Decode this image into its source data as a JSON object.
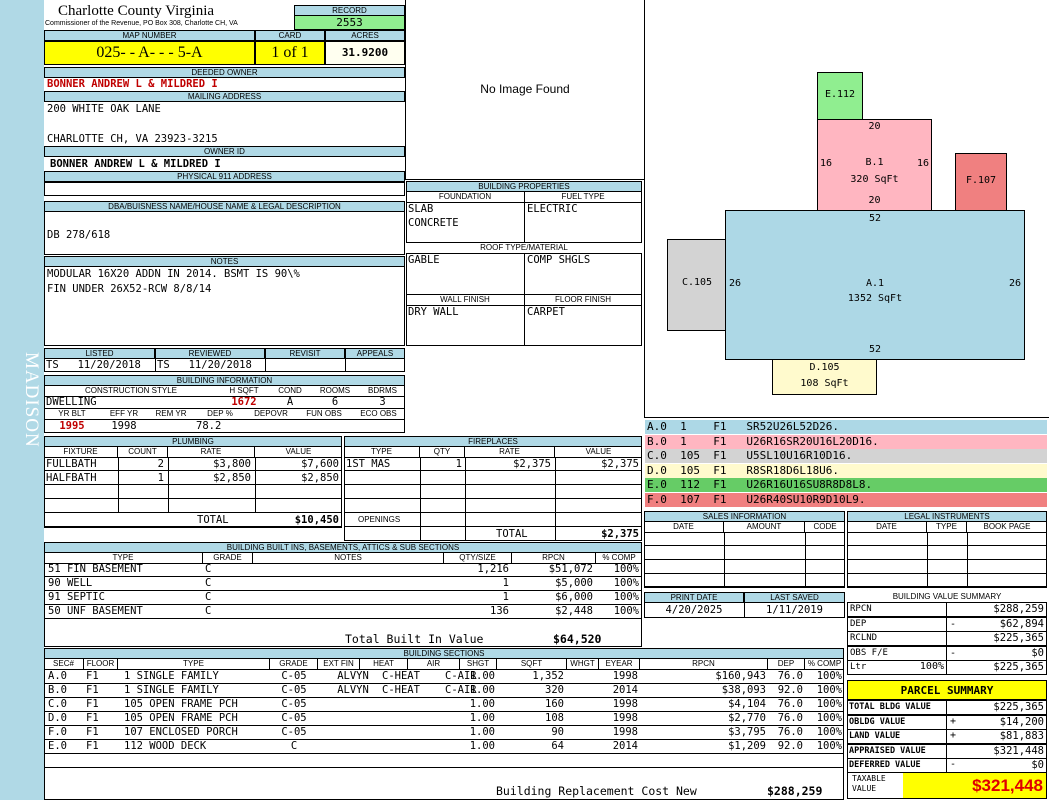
{
  "sidebar": {
    "district": "MADISON"
  },
  "header": {
    "county": "Charlotte County Virginia",
    "subtitle": "Commissioner of the Revenue, PO Box 308, Charlotte CH, VA",
    "record_label": "RECORD",
    "record": "2553",
    "map_label": "MAP NUMBER",
    "map_number": "025- - A- - - 5-A",
    "card_label": "CARD",
    "card": "1 of 1",
    "acres_label": "ACRES",
    "acres": "31.9200"
  },
  "owner": {
    "deeded_label": "DEEDED OWNER",
    "deeded": "BONNER ANDREW L & MILDRED I",
    "mailing_label": "MAILING ADDRESS",
    "addr1": "200 WHITE OAK LANE",
    "addr2": "CHARLOTTE CH, VA 23923-3215",
    "owner_id_label": "OWNER ID",
    "owner_id": "BONNER ANDREW L & MILDRED I",
    "physical_label": "PHYSICAL 911 ADDRESS",
    "physical": ""
  },
  "dba": {
    "label": "DBA/BUISNESS NAME/HOUSE NAME & LEGAL DESCRIPTION",
    "value": "DB 278/618"
  },
  "notes": {
    "label": "NOTES",
    "line1": "MODULAR 16X20 ADDN IN 2014. BSMT IS 90\\%",
    "line2": "FIN UNDER 26X52-RCW 8/8/14"
  },
  "listed": {
    "listed_label": "LISTED",
    "listed": "TS   11/20/2018",
    "reviewed_label": "REVIEWED",
    "reviewed": "TS   11/20/2018",
    "revisit_label": "REVISIT",
    "appeals_label": "APPEALS"
  },
  "photo": {
    "text": "No Image Found"
  },
  "building_props": {
    "label": "BUILDING PROPERTIES",
    "foundation_label": "FOUNDATION",
    "foundation1": "SLAB",
    "foundation2": "CONCRETE",
    "fuel_label": "FUEL TYPE",
    "fuel": "ELECTRIC",
    "roof_label": "ROOF TYPE/MATERIAL",
    "roof_type": "GABLE",
    "roof_mat": "COMP SHGLS",
    "wall_label": "WALL FINISH",
    "wall": "DRY WALL",
    "floor_label": "FLOOR FINISH",
    "floor": "CARPET"
  },
  "building_info": {
    "label": "BUILDING INFORMATION",
    "cs_label": "CONSTRUCTION STYLE",
    "cs": "DWELLING",
    "hsqft_label": "H SQFT",
    "hsqft": "1672",
    "cond_label": "COND",
    "cond": "A",
    "rooms_label": "ROOMS",
    "rooms": "6",
    "bdrms_label": "BDRMS",
    "bdrms": "3",
    "yrblt_label": "YR BLT",
    "yrblt": "1995",
    "effyr_label": "EFF YR",
    "effyr": "1998",
    "remyr_label": "REM YR",
    "remyr": "",
    "dep_label": "DEP %",
    "dep": "78.2",
    "depovr_label": "DEPOVR",
    "funobs_label": "FUN OBS",
    "ecoobs_label": "ECO OBS"
  },
  "plumbing": {
    "label": "PLUMBING",
    "cols": [
      "FIXTURE",
      "COUNT",
      "RATE",
      "VALUE"
    ],
    "rows": [
      [
        "FULLBATH",
        "2",
        "$3,800",
        "$7,600"
      ],
      [
        "HALFBATH",
        "1",
        "$2,850",
        "$2,850"
      ]
    ],
    "total_label": "TOTAL",
    "total": "$10,450"
  },
  "fireplaces": {
    "label": "FIREPLACES",
    "cols": [
      "TYPE",
      "QTY",
      "RATE",
      "VALUE"
    ],
    "rows": [
      [
        "1ST MAS",
        "1",
        "$2,375",
        "$2,375"
      ]
    ],
    "openings_label": "OPENINGS",
    "total_label": "TOTAL",
    "total": "$2,375"
  },
  "builtins": {
    "label": "BUILDING BUILT INS, BASEMENTS, ATTICS & SUB SECTIONS",
    "cols": [
      "TYPE",
      "GRADE",
      "NOTES",
      "QTY/SIZE",
      "RPCN",
      "% COMP"
    ],
    "rows": [
      [
        "51 FIN BASEMENT",
        "C",
        "",
        "1,216",
        "$51,072",
        "100%"
      ],
      [
        "90 WELL",
        "C",
        "",
        "1",
        "$5,000",
        "100%"
      ],
      [
        "91 SEPTIC",
        "C",
        "",
        "1",
        "$6,000",
        "100%"
      ],
      [
        "50 UNF BASEMENT",
        "C",
        "",
        "136",
        "$2,448",
        "100%"
      ]
    ],
    "total_label": "Total Built In Value",
    "total": "$64,520"
  },
  "sections": {
    "label": "BUILDING SECTIONS",
    "cols": [
      "SEC#",
      "FLOOR",
      "TYPE",
      "GRADE",
      "EXT FIN",
      "HEAT",
      "AIR",
      "SHGT",
      "SQFT",
      "WHGT",
      "EYEAR",
      "RPCN",
      "DEP",
      "% COMP"
    ],
    "rows": [
      [
        "A.0",
        "F1",
        "1 SINGLE FAMILY",
        "C-05",
        "ALVYN",
        "C-HEAT",
        "C-AIR",
        "1.00",
        "1,352",
        "",
        "1998",
        "$160,943",
        "76.0",
        "100%"
      ],
      [
        "B.0",
        "F1",
        "1 SINGLE FAMILY",
        "C-05",
        "ALVYN",
        "C-HEAT",
        "C-AIR",
        "1.00",
        "320",
        "",
        "2014",
        "$38,093",
        "92.0",
        "100%"
      ],
      [
        "C.0",
        "F1",
        "105 OPEN FRAME PCH",
        "C-05",
        "",
        "",
        "",
        "1.00",
        "160",
        "",
        "1998",
        "$4,104",
        "76.0",
        "100%"
      ],
      [
        "D.0",
        "F1",
        "105 OPEN FRAME PCH",
        "C-05",
        "",
        "",
        "",
        "1.00",
        "108",
        "",
        "1998",
        "$2,770",
        "76.0",
        "100%"
      ],
      [
        "F.0",
        "F1",
        "107 ENCLOSED PORCH",
        "C-05",
        "",
        "",
        "",
        "1.00",
        "90",
        "",
        "1998",
        "$3,795",
        "76.0",
        "100%"
      ],
      [
        "E.0",
        "F1",
        "112 WOOD DECK",
        "C",
        "",
        "",
        "",
        "1.00",
        "64",
        "",
        "2014",
        "$1,209",
        "92.0",
        "100%"
      ]
    ],
    "rcn_label": "Building Replacement Cost New",
    "rcn": "$288,259"
  },
  "sketch": {
    "E": {
      "code": "E.112"
    },
    "B": {
      "code": "B.1",
      "area": "320 SqFt",
      "top": "20",
      "left": "16",
      "right": "16",
      "bottom": "20"
    },
    "F": {
      "code": "F.107"
    },
    "A": {
      "code": "A.1",
      "area": "1352 SqFt",
      "top": "52",
      "left": "26",
      "right": "26",
      "bottom": "52"
    },
    "C": {
      "code": "C.105"
    },
    "D": {
      "code": "D.105",
      "area": "108 SqFt"
    },
    "fill_a": "#add8e6",
    "fill_b": "#ffb6c1",
    "fill_c": "#d3d3d3",
    "fill_d": "#fffacd",
    "fill_e": "#90ee90",
    "fill_f": "#f08080"
  },
  "legend": [
    {
      "text": "A.0  1    F1   SR52U26L52D26.",
      "color": "#add8e6"
    },
    {
      "text": "B.0  1    F1   U26R16SR20U16L20D16.",
      "color": "#ffb6c1"
    },
    {
      "text": "C.0  105  F1   U5SL10U16R10D16.",
      "color": "#d3d3d3"
    },
    {
      "text": "D.0  105  F1   R8SR18D6L18U6.",
      "color": "#fffacd"
    },
    {
      "text": "E.0  112  F1   U26R16U16SU8R8D8L8.",
      "color": "#66cc66"
    },
    {
      "text": "F.0  107  F1   U26R40SU10R9D10L9.",
      "color": "#f08080"
    }
  ],
  "sales": {
    "label": "SALES INFORMATION",
    "cols": [
      "DATE",
      "AMOUNT",
      "CODE"
    ]
  },
  "legal": {
    "label": "LEGAL INSTRUMENTS",
    "cols": [
      "DATE",
      "TYPE",
      "BOOK PAGE"
    ]
  },
  "dates": {
    "print_label": "PRINT DATE",
    "print": "4/20/2025",
    "saved_label": "LAST SAVED",
    "saved": "1/11/2019"
  },
  "bvs": {
    "label": "BUILDING VALUE SUMMARY",
    "rows": [
      {
        "k": "RPCN",
        "s": "",
        "v": "$288,259"
      },
      {
        "k": "DEP",
        "s": "-",
        "v": "$62,894"
      },
      {
        "k": "RCLND",
        "s": "",
        "v": "$225,365"
      },
      {
        "k": "OBS F/E",
        "s": "-",
        "v": "$0"
      },
      {
        "k": "Ltr",
        "s": "100%",
        "v": "$225,365"
      }
    ]
  },
  "parcel": {
    "label": "PARCEL SUMMARY",
    "rows": [
      {
        "k": "TOTAL BLDG VALUE",
        "s": "",
        "v": "$225,365"
      },
      {
        "k": "OBLDG VALUE",
        "s": "+",
        "v": "$14,200"
      },
      {
        "k": "LAND VALUE",
        "s": "+",
        "v": "$81,883"
      },
      {
        "k": "APPRAISED VALUE",
        "s": "",
        "v": "$321,448"
      },
      {
        "k": "DEFERRED VALUE",
        "s": "-",
        "v": "$0"
      }
    ],
    "taxable_label": "TAXABLE VALUE",
    "taxable": "$321,448"
  }
}
